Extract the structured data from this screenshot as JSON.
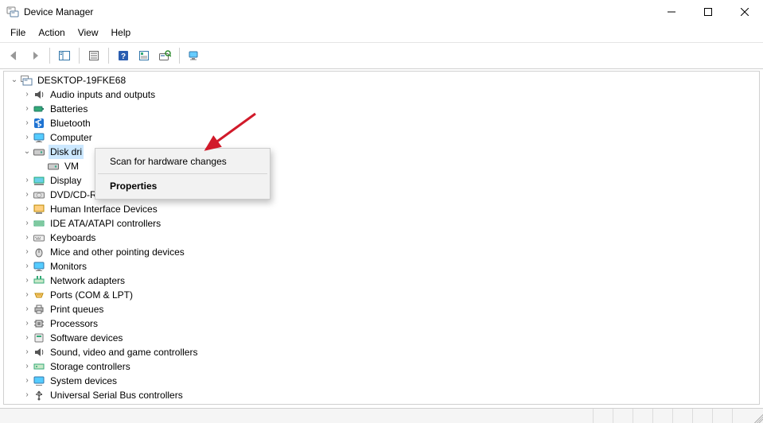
{
  "window": {
    "title": "Device Manager"
  },
  "menu": {
    "file": "File",
    "action": "Action",
    "view": "View",
    "help": "Help"
  },
  "tree": {
    "root": "DESKTOP-19FKE68",
    "items": [
      {
        "label": "Audio inputs and outputs"
      },
      {
        "label": "Batteries"
      },
      {
        "label": "Bluetooth"
      },
      {
        "label": "Computer"
      },
      {
        "label": "Disk drives",
        "expanded": true,
        "selected": true,
        "visibleLabel": "Disk dri",
        "children": [
          {
            "label": "VMware Virtual NVMe Disk",
            "visibleLabel": "VM"
          }
        ]
      },
      {
        "label": "Display adapters",
        "visibleLabel": "Display"
      },
      {
        "label": "DVD/CD-ROM drives",
        "visibleLabel": "DVD/CD-ROM unves"
      },
      {
        "label": "Human Interface Devices"
      },
      {
        "label": "IDE ATA/ATAPI controllers"
      },
      {
        "label": "Keyboards"
      },
      {
        "label": "Mice and other pointing devices"
      },
      {
        "label": "Monitors"
      },
      {
        "label": "Network adapters"
      },
      {
        "label": "Ports (COM & LPT)"
      },
      {
        "label": "Print queues"
      },
      {
        "label": "Processors"
      },
      {
        "label": "Software devices"
      },
      {
        "label": "Sound, video and game controllers"
      },
      {
        "label": "Storage controllers"
      },
      {
        "label": "System devices"
      },
      {
        "label": "Universal Serial Bus controllers"
      }
    ]
  },
  "contextMenu": {
    "scan": "Scan for hardware changes",
    "properties": "Properties"
  },
  "colors": {
    "arrow": "#d11a2a",
    "selection": "#cce8ff"
  }
}
